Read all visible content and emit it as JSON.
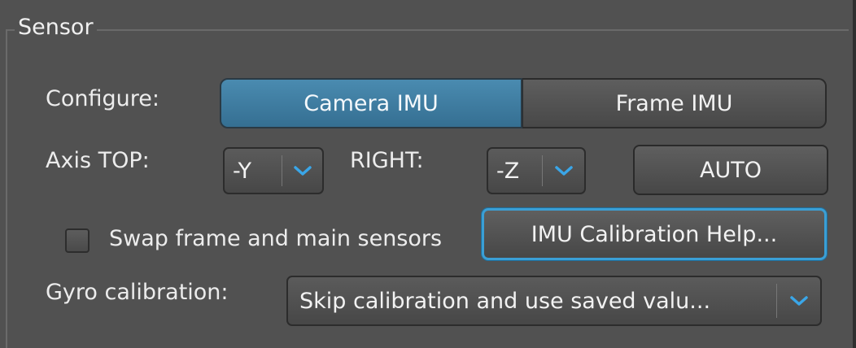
{
  "group": {
    "title": "Sensor"
  },
  "configure": {
    "label": "Configure:",
    "options": [
      "Camera IMU",
      "Frame IMU"
    ],
    "selected": "Camera IMU"
  },
  "axis": {
    "top_label": "Axis TOP:",
    "top_value": "-Y",
    "right_label": "RIGHT:",
    "right_value": "-Z",
    "auto_label": "AUTO"
  },
  "swap": {
    "label": "Swap frame and main sensors",
    "checked": false
  },
  "help_button": {
    "label": "IMU Calibration Help..."
  },
  "gyro": {
    "label": "Gyro calibration:",
    "value": "Skip calibration and use saved valu..."
  },
  "colors": {
    "accent": "#3a9fd6",
    "selected_segment": "#4a8bb0",
    "panel": "#515151"
  },
  "icons": {
    "dropdown": "chevron-down-icon"
  }
}
